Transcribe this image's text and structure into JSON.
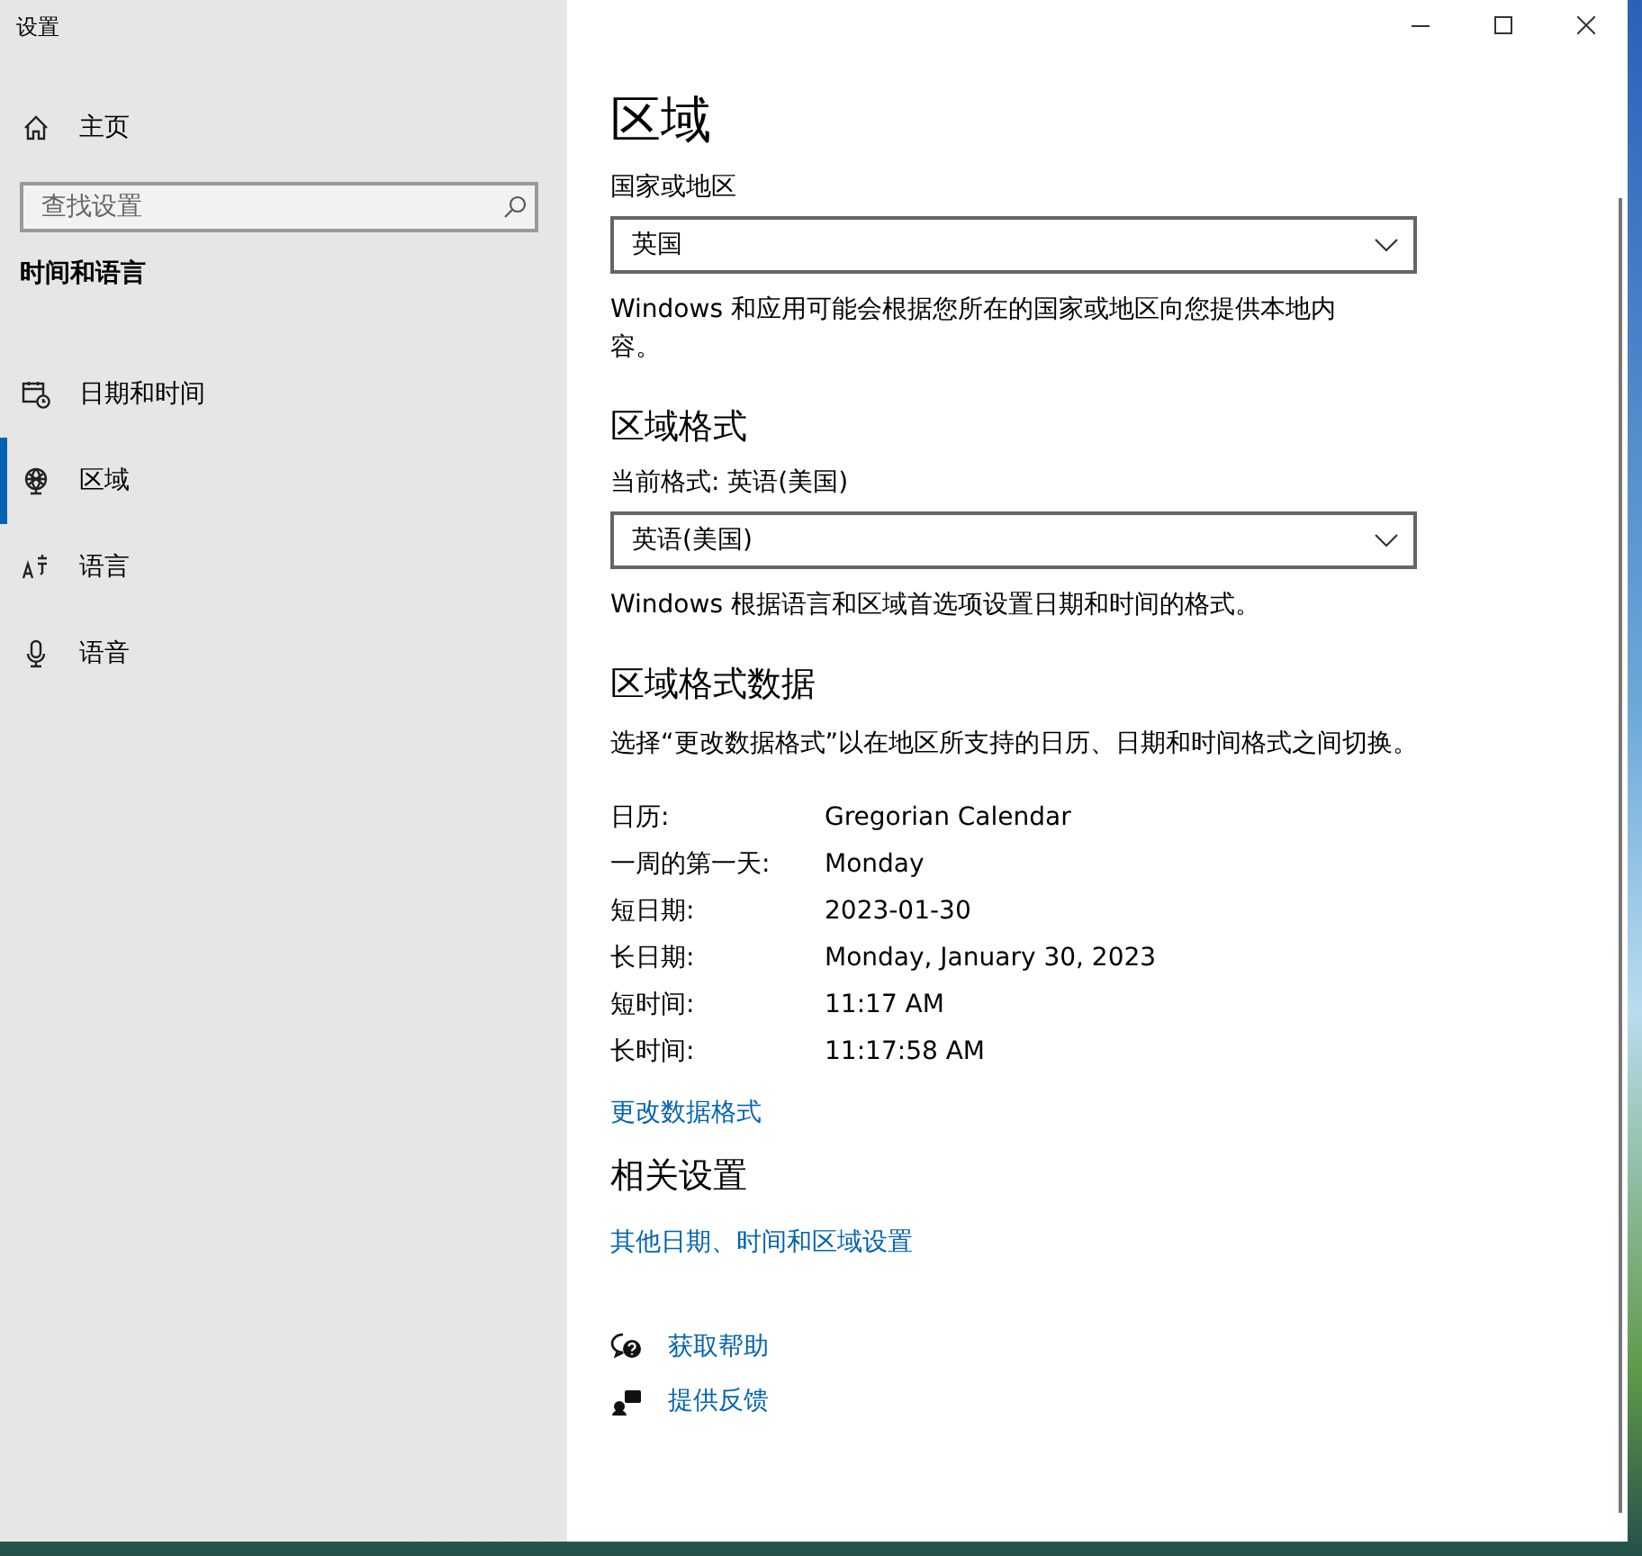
{
  "window": {
    "title": "设置"
  },
  "sidebar": {
    "home": "主页",
    "search": {
      "placeholder": "查找设置"
    },
    "section": "时间和语言",
    "items": [
      {
        "label": "日期和时间",
        "selected": false
      },
      {
        "label": "区域",
        "selected": true
      },
      {
        "label": "语言",
        "selected": false
      },
      {
        "label": "语音",
        "selected": false
      }
    ]
  },
  "main": {
    "title": "区域",
    "country": {
      "label": "国家或地区",
      "value": "英国",
      "description": "Windows 和应用可能会根据您所在的国家或地区向您提供本地内容。"
    },
    "format": {
      "heading": "区域格式",
      "label": "当前格式: 英语(美国)",
      "value": "英语(美国)",
      "description": "Windows 根据语言和区域首选项设置日期和时间的格式。"
    },
    "format_data": {
      "heading": "区域格式数据",
      "description": "选择“更改数据格式”以在地区所支持的日历、日期和时间格式之间切换。",
      "rows": [
        {
          "label": "日历:",
          "value": "Gregorian Calendar"
        },
        {
          "label": "一周的第一天:",
          "value": "Monday"
        },
        {
          "label": "短日期:",
          "value": "2023-01-30"
        },
        {
          "label": "长日期:",
          "value": "Monday, January 30, 2023"
        },
        {
          "label": "短时间:",
          "value": "11:17 AM"
        },
        {
          "label": "长时间:",
          "value": "11:17:58 AM"
        }
      ],
      "link": "更改数据格式"
    },
    "related": {
      "heading": "相关设置",
      "link": "其他日期、时间和区域设置"
    },
    "help": [
      {
        "label": "获取帮助"
      },
      {
        "label": "提供反馈"
      }
    ]
  }
}
